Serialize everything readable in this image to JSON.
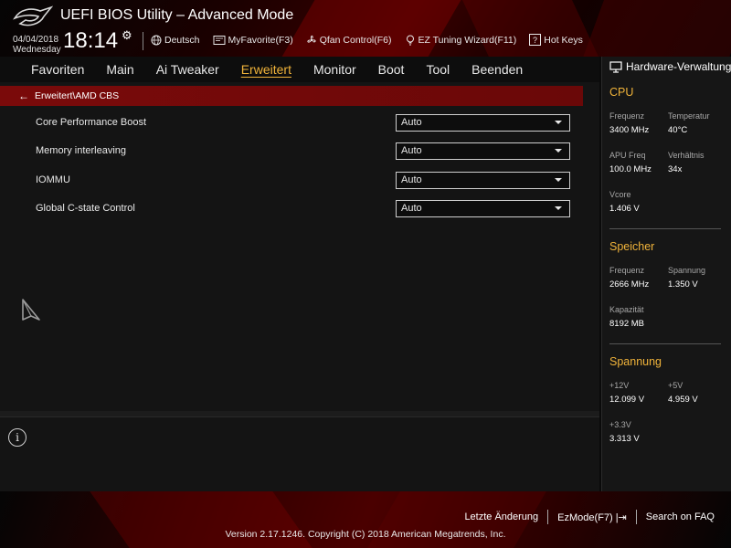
{
  "header": {
    "title": "UEFI BIOS Utility – Advanced Mode",
    "date": "04/04/2018",
    "weekday": "Wednesday",
    "time": "18:14",
    "toolbar": [
      {
        "icon": "globe-icon",
        "label": "Deutsch"
      },
      {
        "icon": "favorite-icon",
        "label": "MyFavorite(F3)"
      },
      {
        "icon": "fan-icon",
        "label": "Qfan Control(F6)"
      },
      {
        "icon": "lightbulb-icon",
        "label": "EZ Tuning Wizard(F11)"
      },
      {
        "icon": "help-icon",
        "label": "Hot Keys"
      }
    ]
  },
  "menu": {
    "items": [
      "Favoriten",
      "Main",
      "Ai Tweaker",
      "Erweitert",
      "Monitor",
      "Boot",
      "Tool",
      "Beenden"
    ],
    "active": "Erweitert"
  },
  "breadcrumb": "Erweitert\\AMD CBS",
  "settings": [
    {
      "label": "Core Performance Boost",
      "value": "Auto"
    },
    {
      "label": "Memory interleaving",
      "value": "Auto"
    },
    {
      "label": "IOMMU",
      "value": "Auto"
    },
    {
      "label": "Global C-state Control",
      "value": "Auto"
    }
  ],
  "sidebar": {
    "title": "Hardware-Verwaltung",
    "cpu": {
      "heading": "CPU",
      "freq_label": "Frequenz",
      "freq_value": "3400 MHz",
      "temp_label": "Temperatur",
      "temp_value": "40°C",
      "apu_label": "APU Freq",
      "apu_value": "100.0 MHz",
      "ratio_label": "Verhältnis",
      "ratio_value": "34x",
      "vcore_label": "Vcore",
      "vcore_value": "1.406 V"
    },
    "memory": {
      "heading": "Speicher",
      "freq_label": "Frequenz",
      "freq_value": "2666 MHz",
      "volt_label": "Spannung",
      "volt_value": "1.350 V",
      "cap_label": "Kapazität",
      "cap_value": "8192 MB"
    },
    "voltage": {
      "heading": "Spannung",
      "v12_label": "+12V",
      "v12_value": "12.099 V",
      "v5_label": "+5V",
      "v5_value": "4.959 V",
      "v33_label": "+3.3V",
      "v33_value": "3.313 V"
    }
  },
  "footer": {
    "last_change": "Letzte Änderung",
    "ezmode": "EzMode(F7)",
    "faq": "Search on FAQ",
    "version": "Version 2.17.1246. Copyright (C) 2018 American Megatrends, Inc."
  },
  "colors": {
    "accent": "#f0b33a",
    "breadcrumb_bg": "#7a0a0a"
  }
}
